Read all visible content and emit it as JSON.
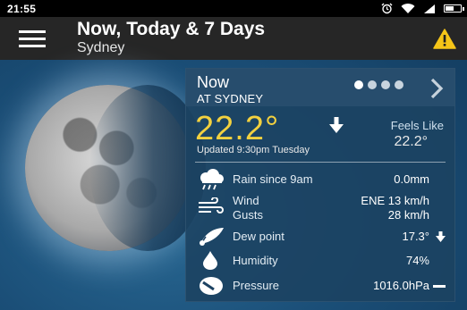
{
  "status_bar": {
    "time": "21:55",
    "battery_level": 0.6
  },
  "app_bar": {
    "title": "Now, Today & 7 Days",
    "subtitle": "Sydney"
  },
  "card": {
    "header": "Now",
    "location": "AT SYDNEY",
    "page_dots": {
      "total": 4,
      "active": 1
    },
    "temperature": "22.2°",
    "updated": "Updated 9:30pm Tuesday",
    "feels_like_label": "Feels Like",
    "feels_like_value": "22.2°",
    "rain_label": "Rain since 9am",
    "rain_value": "0.0mm",
    "wind_label": "Wind",
    "wind_value": "ENE 13 km/h",
    "gusts_label": "Gusts",
    "gusts_value": "28 km/h",
    "dew_point_label": "Dew point",
    "dew_point_value": "17.3°",
    "humidity_label": "Humidity",
    "humidity_value": "74%",
    "pressure_label": "Pressure",
    "pressure_value": "1016.0hPa"
  },
  "colors": {
    "temperature": "#f3d13f",
    "alert": "#f5c518",
    "app_bar": "#262626",
    "card": "#1c4262"
  },
  "icons": [
    "alarm-icon",
    "wifi-icon",
    "signal-icon",
    "battery-icon",
    "menu-icon",
    "alert-triangle-icon",
    "chevron-right-icon",
    "arrow-down-icon",
    "rain-cloud-icon",
    "wind-icon",
    "dew-drop-icon",
    "humidity-drop-icon",
    "pressure-icon",
    "steady-dash-icon"
  ]
}
